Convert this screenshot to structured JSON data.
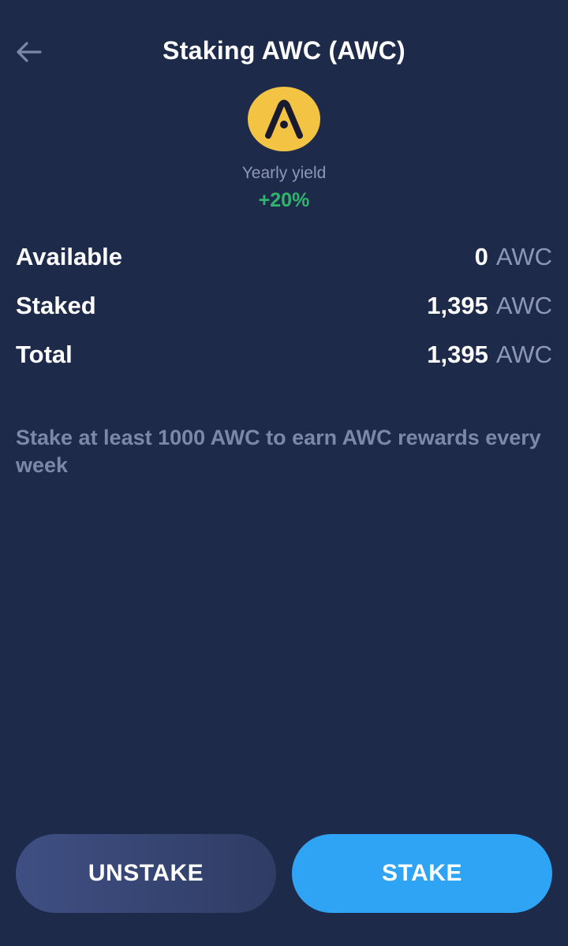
{
  "header": {
    "title": "Staking AWC (AWC)",
    "back_icon": "arrow-left-icon"
  },
  "token": {
    "logo_icon": "awc-logo-icon",
    "logo_color": "#f3c344",
    "yield_label": "Yearly yield",
    "yield_value": "+20%"
  },
  "balances": [
    {
      "label": "Available",
      "amount": "0",
      "unit": "AWC"
    },
    {
      "label": "Staked",
      "amount": "1,395",
      "unit": "AWC"
    },
    {
      "label": "Total",
      "amount": "1,395",
      "unit": "AWC"
    }
  ],
  "info_text": "Stake at least 1000 AWC to earn AWC rewards every week",
  "actions": {
    "unstake_label": "UNSTAKE",
    "stake_label": "STAKE"
  },
  "colors": {
    "background": "#1e2a4a",
    "accent": "#2fa4f5",
    "positive": "#2fb56b"
  }
}
